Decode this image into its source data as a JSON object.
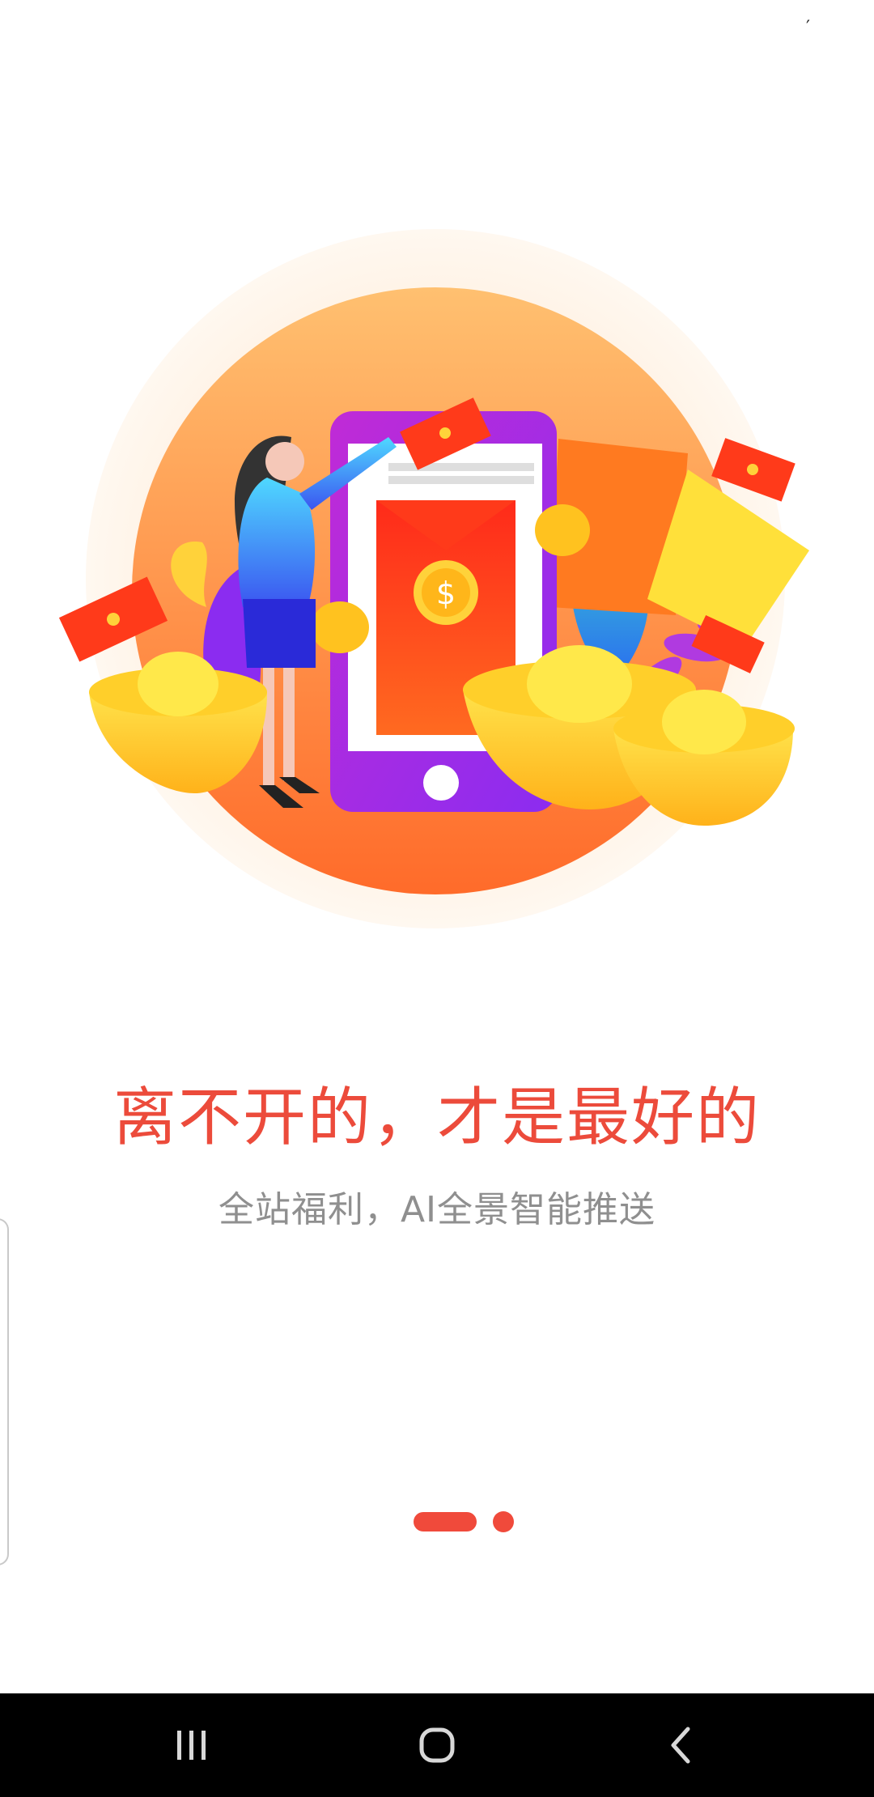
{
  "status_bar": {
    "mark": "′"
  },
  "onboarding": {
    "title": "离不开的，才是最好的",
    "subtitle": "全站福利，AI全景智能推送",
    "page_index": 1,
    "page_count": 2
  },
  "illustration": {
    "description_icon": "woman-phone-red-envelope-coins-icon",
    "coin_symbol": "$"
  },
  "navbar": {
    "recents_icon": "recents-icon",
    "home_icon": "home-icon",
    "back_icon": "back-icon"
  },
  "colors": {
    "accent": "#f04a3b",
    "title": "#ec4b3b",
    "subtitle": "#8f8f8f",
    "navbar": "#000000"
  }
}
